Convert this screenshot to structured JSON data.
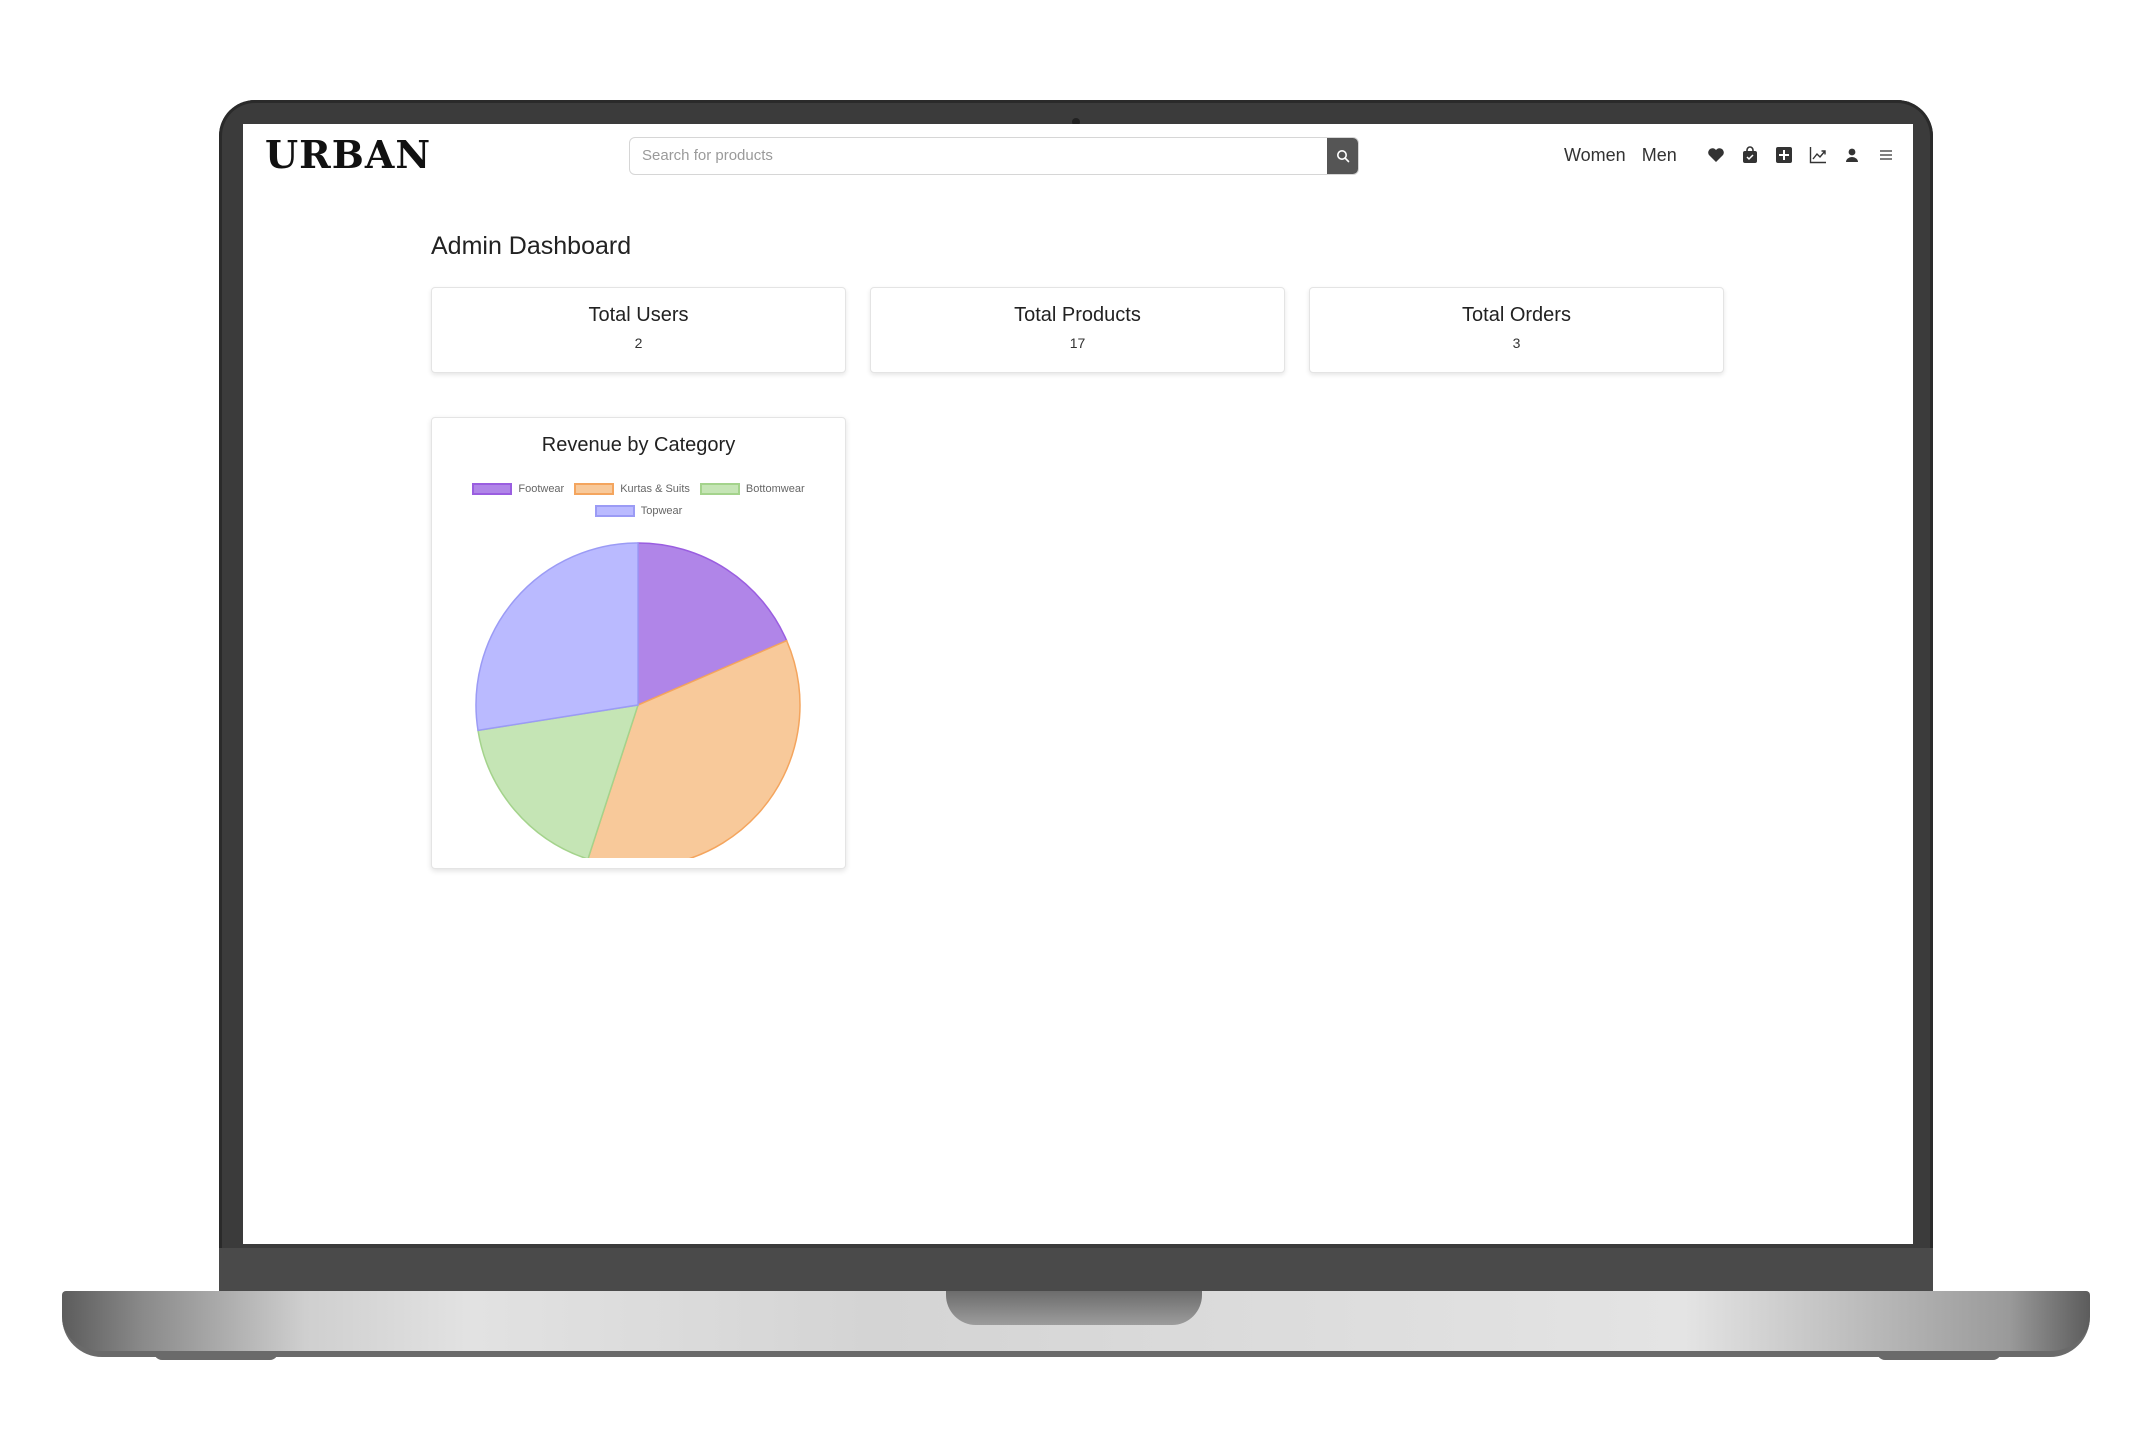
{
  "brand": {
    "logo": "URBAN"
  },
  "search": {
    "placeholder": "Search for products"
  },
  "nav": {
    "links": [
      "Women",
      "Men"
    ],
    "icons": [
      "heart-icon",
      "shopping-bag-icon",
      "add-box-icon",
      "trending-chart-icon",
      "user-icon",
      "menu-icon"
    ]
  },
  "page": {
    "title": "Admin Dashboard"
  },
  "stats": [
    {
      "label": "Total Users",
      "value": "2"
    },
    {
      "label": "Total Products",
      "value": "17"
    },
    {
      "label": "Total Orders",
      "value": "3"
    }
  ],
  "chart_data": {
    "type": "pie",
    "title": "Revenue by Category",
    "labels": [
      "Footwear",
      "Kurtas & Suits",
      "Bottomwear",
      "Topwear"
    ],
    "values": [
      18.5,
      36.5,
      17.5,
      27.5
    ],
    "colors": [
      "#b085e8",
      "#f8c99a",
      "#c5e5b5",
      "#babaff"
    ],
    "border_colors": [
      "#9a5ee0",
      "#f4a55e",
      "#a4d38c",
      "#9b9bf5"
    ],
    "legend_position": "top"
  }
}
